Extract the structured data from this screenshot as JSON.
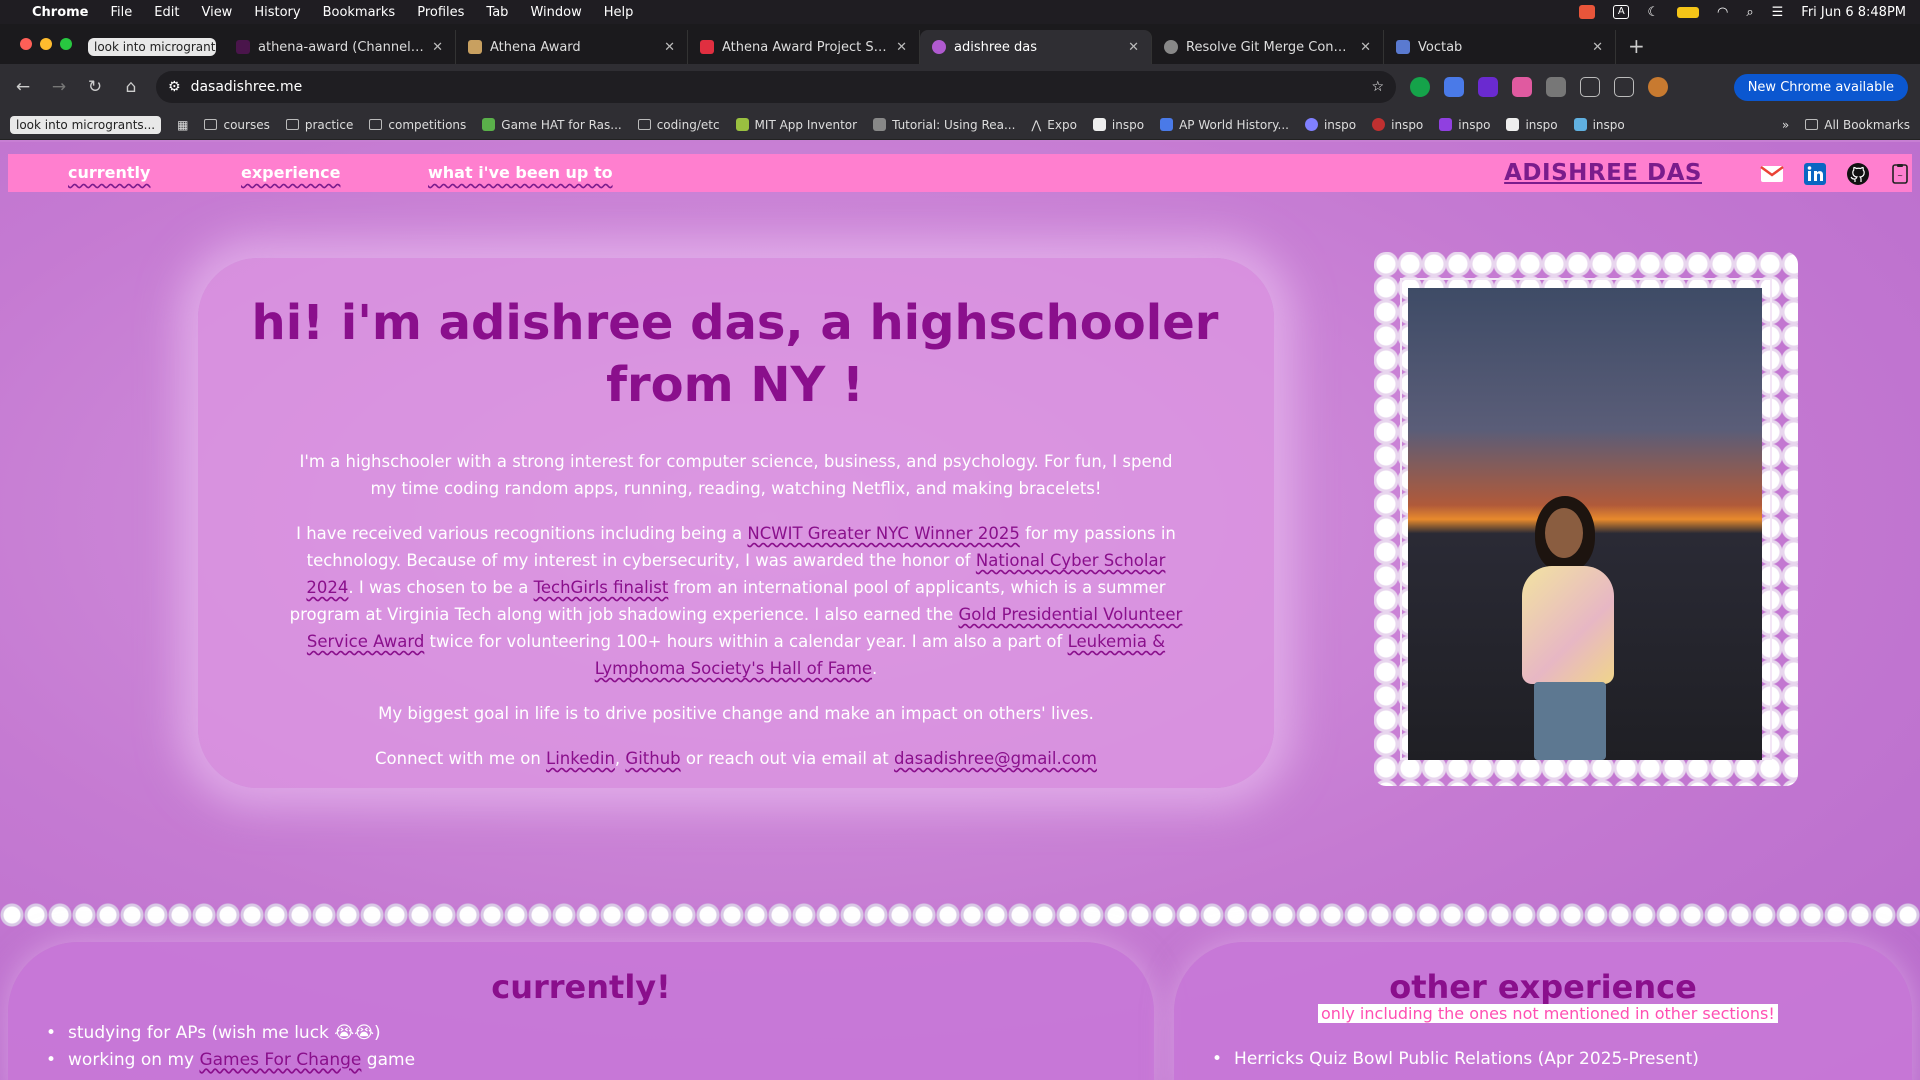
{
  "menubar": {
    "app": "Chrome",
    "items": [
      "File",
      "Edit",
      "View",
      "History",
      "Bookmarks",
      "Profiles",
      "Tab",
      "Window",
      "Help"
    ],
    "datetime": "Fri Jun 6  8:48PM"
  },
  "tabs": {
    "pill": "look into microgrants",
    "items": [
      {
        "label": "athena-award (Channel) - Ha",
        "color": "#4a154b"
      },
      {
        "label": "Athena Award",
        "color": "#c8a060"
      },
      {
        "label": "Athena Award Project Submis",
        "color": "#e02f40"
      },
      {
        "label": "adishree das",
        "color": "#b05ad0"
      },
      {
        "label": "Resolve Git Merge Conflict",
        "color": "#888888"
      },
      {
        "label": "Voctab",
        "color": "#5a7ad0"
      }
    ]
  },
  "address": {
    "url": "dasadishree.me",
    "new_chrome": "New Chrome available"
  },
  "bookmarks": {
    "first": "look into microgrants...",
    "items": [
      "courses",
      "practice",
      "competitions",
      "Game HAT for Ras...",
      "coding/etc",
      "MIT App Inventor",
      "Tutorial: Using Rea...",
      "Expo",
      "inspo",
      "AP World History...",
      "inspo",
      "inspo",
      "inspo",
      "inspo",
      "inspo"
    ],
    "more": "»",
    "all": "All Bookmarks"
  },
  "site": {
    "nav": {
      "currently": "currently",
      "experience": "experience",
      "up_to": "what i've been up to"
    },
    "brand": "ADISHREE DAS",
    "hero": {
      "title": "hi! i'm adishree das, a highschooler from NY !",
      "p1": "I'm a highschooler with a strong interest for computer science, business, and psychology. For fun, I spend my time coding random apps, running, reading, watching Netflix, and making bracelets!",
      "p2a": "I have received various recognitions including being a ",
      "p2_link1": "NCWIT Greater NYC Winner 2025",
      "p2b": " for my passions in technology. Because of my interest in cybersecurity, I was awarded the honor of ",
      "p2_link2": "National Cyber Scholar 2024",
      "p2c": ". I was chosen to be a ",
      "p2_link3": "TechGirls finalist",
      "p2d": " from an international pool of applicants, which is a summer program at Virginia Tech along with job shadowing experience. I also earned the ",
      "p2_link4": "Gold Presidential Volunteer Service Award",
      "p2e": " twice for volunteering 100+ hours within a calendar year. I am also a part of ",
      "p2_link5": "Leukemia & Lymphoma Society's Hall of Fame",
      "p2f": ".",
      "p3": "My biggest goal in life is to drive positive change and make an impact on others' lives.",
      "p4a": "Connect with me on ",
      "p4_linkedin": "Linkedin",
      "p4_sep": ", ",
      "p4_github": "Github",
      "p4b": " or reach out via email at ",
      "p4_email": "dasadishree@gmail.com"
    },
    "currently": {
      "title": "currently!",
      "item1": "studying for APs (wish me luck 😭😭)",
      "item2a": "working on my ",
      "item2_link": "Games For Change",
      "item2b": " game"
    },
    "experience": {
      "title": "other experience",
      "subtitle": "only including the ones not mentioned in other sections!",
      "item1": "Herricks Quiz Bowl Public Relations (Apr 2025-Present)"
    }
  },
  "colors": {
    "nav_bg": "#ff7fcf",
    "accent": "#8a0f8c",
    "page_bg": "#c77fd3"
  }
}
